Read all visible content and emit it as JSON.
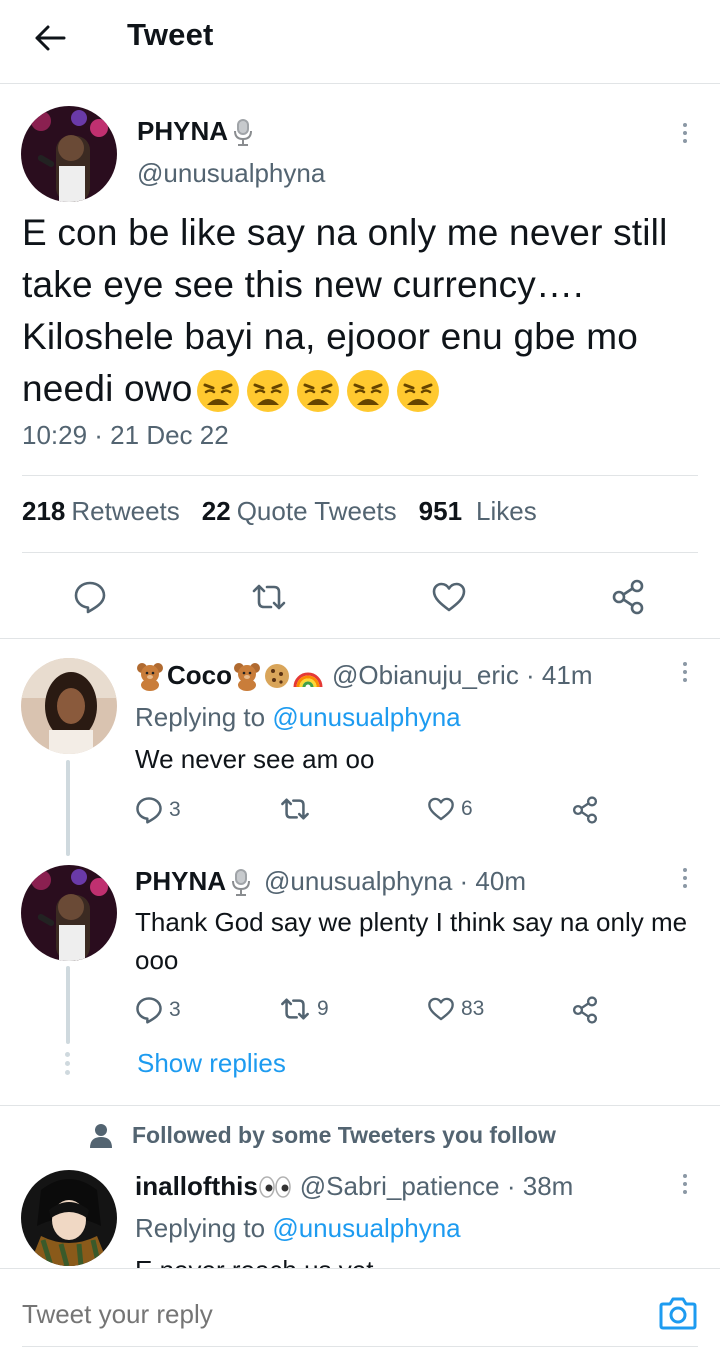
{
  "header": {
    "title": "Tweet"
  },
  "main_tweet": {
    "name": "PHYNA",
    "handle": "@unusualphyna",
    "text": "E con be like say na only me never still take eye see this new currency…. Kiloshele bayi na, ejooor enu gbe mo needi owo",
    "emoji_count": 5,
    "timestamp": "10:29 · 21 Dec 22",
    "stats": {
      "retweets_count": "218",
      "retweets_label": "Retweets",
      "quotes_count": "22",
      "quotes_label": "Quote Tweets",
      "likes_count": "951",
      "likes_label": "Likes"
    }
  },
  "replies": [
    {
      "name": "Coco",
      "handle": "@Obianuju_eric · 41m",
      "replying_prefix": "Replying to ",
      "replying_to": "@unusualphyna",
      "text": "We never see am oo",
      "replies": "3",
      "retweets": "",
      "likes": "6"
    },
    {
      "name": "PHYNA",
      "handle": "@unusualphyna · 40m",
      "text": "Thank God say we plenty I think say na only me ooo",
      "replies": "3",
      "retweets": "9",
      "likes": "83"
    },
    {
      "name": "inallofthis",
      "handle": "@Sabri_patience · 38m",
      "replying_prefix": "Replying to ",
      "replying_to": "@unusualphyna",
      "text": "E never reach us yet"
    }
  ],
  "show_replies": "Show replies",
  "social_context": "Followed by some Tweeters you follow",
  "reply_bar": {
    "placeholder": "Tweet your reply"
  },
  "colors": {
    "accent": "#1d9bf0",
    "secondary_text": "#536471",
    "divider": "#e1e4e6"
  }
}
